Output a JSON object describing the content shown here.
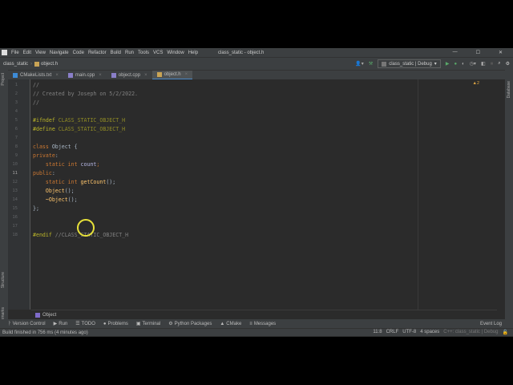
{
  "window": {
    "title": "class_static - object.h"
  },
  "menu": [
    "File",
    "Edit",
    "View",
    "Navigate",
    "Code",
    "Refactor",
    "Build",
    "Run",
    "Tools",
    "VCS",
    "Window",
    "Help"
  ],
  "nav": {
    "project": "class_static",
    "file": "object.h",
    "config": "class_static | Debug"
  },
  "tabs": [
    {
      "label": "CMakeLists.txt"
    },
    {
      "label": "main.cpp"
    },
    {
      "label": "object.cpp"
    },
    {
      "label": "object.h"
    }
  ],
  "side": {
    "left_top": "Project",
    "left_mid": "Structure",
    "left_bottom": "Bookmarks",
    "right": "Database"
  },
  "editor": {
    "warnings": "2",
    "lines": [
      [
        {
          "t": "//",
          "c": "cm"
        }
      ],
      [
        {
          "t": "// Created by Joseph on 5/2/2022.",
          "c": "cm"
        }
      ],
      [
        {
          "t": "//",
          "c": "cm"
        }
      ],
      [],
      [
        {
          "t": "#ifndef ",
          "c": "pp"
        },
        {
          "t": "CLASS_STATIC_OBJECT_H",
          "c": "mac"
        }
      ],
      [
        {
          "t": "#define ",
          "c": "pp"
        },
        {
          "t": "CLASS_STATIC_OBJECT_H",
          "c": "mac"
        }
      ],
      [],
      [
        {
          "t": "class ",
          "c": "kw"
        },
        {
          "t": "Object",
          "c": ""
        },
        {
          "t": " {",
          "c": ""
        }
      ],
      [
        {
          "t": "private",
          "c": "kw"
        },
        {
          "t": ":",
          "c": ""
        }
      ],
      [
        {
          "t": "    static int ",
          "c": "kw"
        },
        {
          "t": "count",
          "c": "cls"
        },
        {
          "t": ";",
          "c": "kw"
        }
      ],
      [
        {
          "t": "public",
          "c": "kw"
        },
        {
          "t": ":",
          "c": ""
        }
      ],
      [
        {
          "t": "    static int ",
          "c": "kw"
        },
        {
          "t": "getCount",
          "c": "fn"
        },
        {
          "t": "();",
          "c": ""
        }
      ],
      [
        {
          "t": "    Object",
          "c": "fn"
        },
        {
          "t": "();",
          "c": ""
        }
      ],
      [
        {
          "t": "    ~Object",
          "c": "fn"
        },
        {
          "t": "();",
          "c": ""
        }
      ],
      [
        {
          "t": "};",
          "c": ""
        }
      ],
      [],
      [],
      [
        {
          "t": "#endif ",
          "c": "pp"
        },
        {
          "t": "//CLASS_STATIC_OBJECT_H",
          "c": "cm"
        }
      ]
    ]
  },
  "breadcrumb": "Object",
  "toolwindows": [
    "Version Control",
    "Run",
    "TODO",
    "Problems",
    "Terminal",
    "Python Packages",
    "CMake",
    "Messages"
  ],
  "event_log": "Event Log",
  "status": {
    "message": "Build finished in 756 ms (4 minutes ago)",
    "position": "11:8",
    "line_sep": "CRLF",
    "encoding": "UTF-8",
    "indent": "4 spaces",
    "context": "C++: class_static | Debug"
  }
}
